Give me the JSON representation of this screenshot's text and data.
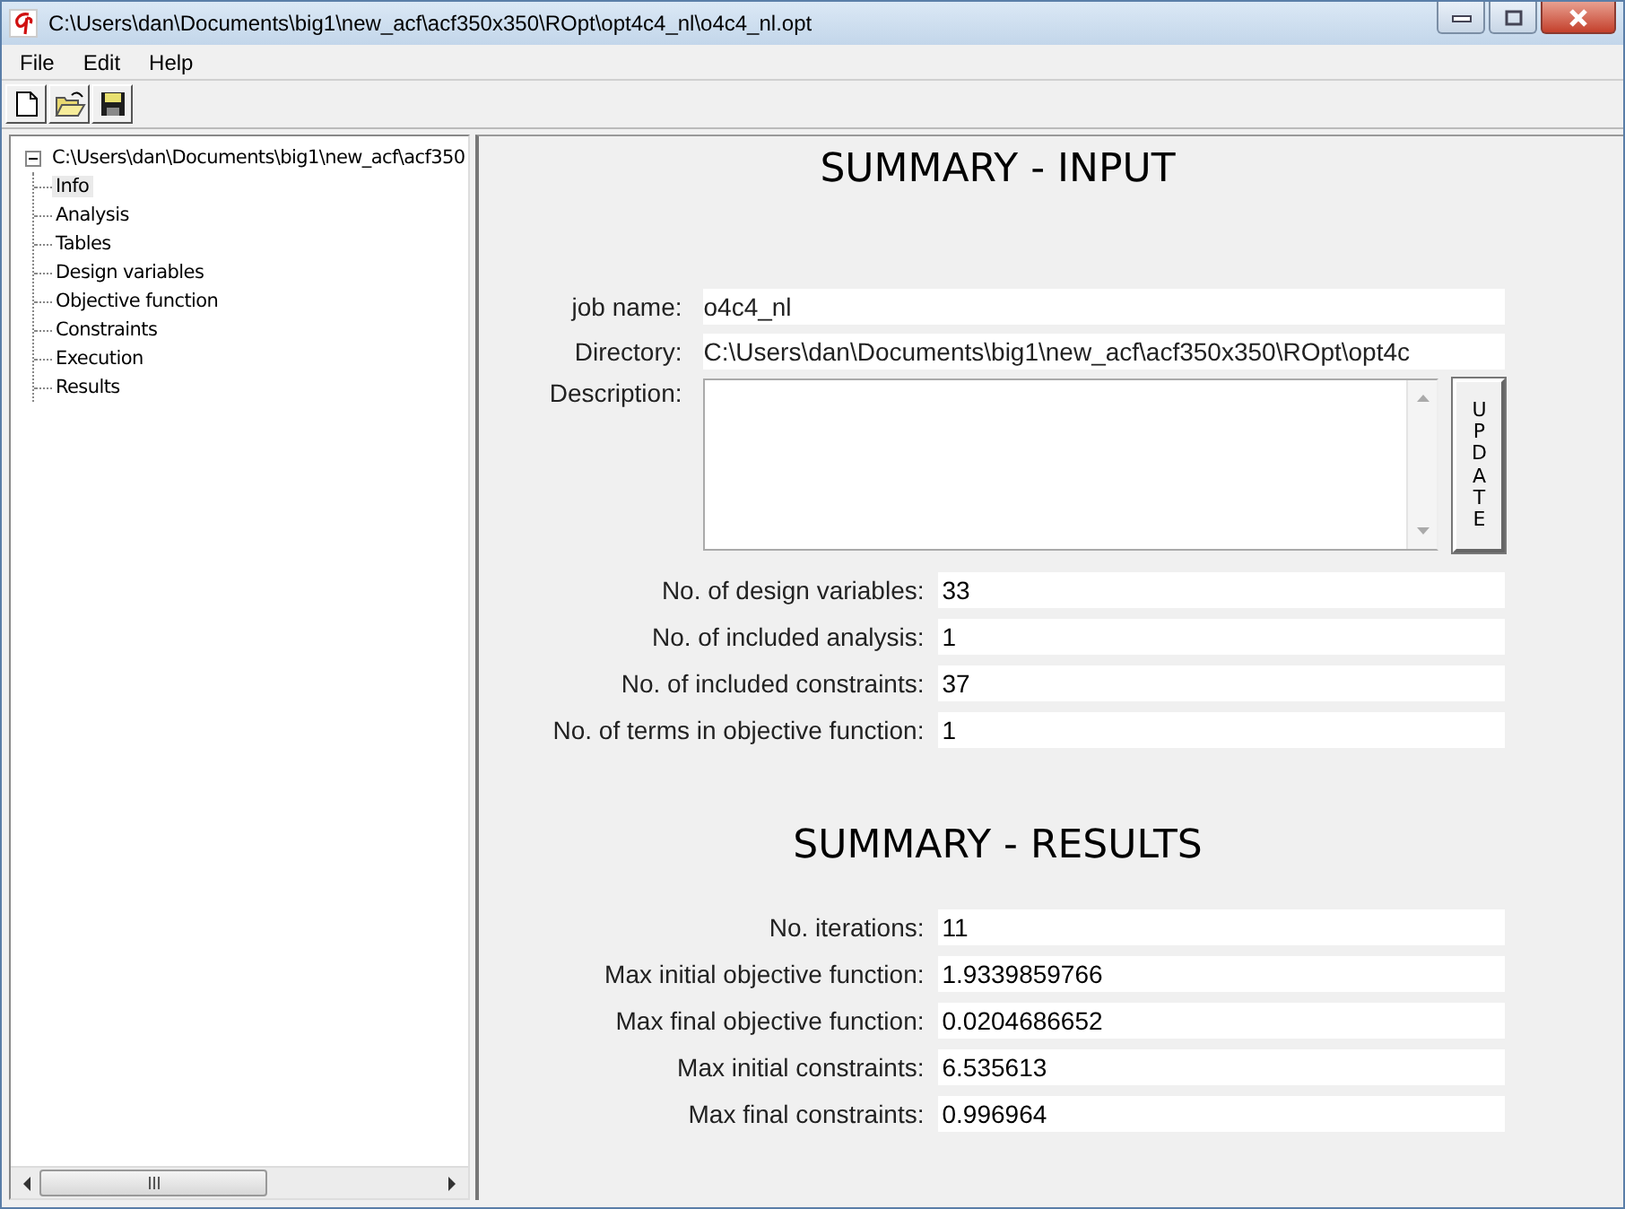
{
  "window": {
    "title": "C:\\Users\\dan\\Documents\\big1\\new_acf\\acf350x350\\ROpt\\opt4c4_nl\\o4c4_nl.opt"
  },
  "menu": [
    "File",
    "Edit",
    "Help"
  ],
  "tree": {
    "label": "C:\\Users\\dan\\Documents\\big1\\new_acf\\acf350",
    "expanded": true,
    "children": [
      {
        "label": "Info",
        "selected": true
      },
      {
        "label": "Analysis",
        "selected": false
      },
      {
        "label": "Tables",
        "selected": false
      },
      {
        "label": "Design variables",
        "selected": false
      },
      {
        "label": "Objective function",
        "selected": false
      },
      {
        "label": "Constraints",
        "selected": false
      },
      {
        "label": "Execution",
        "selected": false
      },
      {
        "label": "Results",
        "selected": false
      }
    ]
  },
  "input_summary": {
    "heading": "SUMMARY - INPUT",
    "job_name_label": "job name:",
    "job_name": "o4c4_nl",
    "directory_label": "Directory:",
    "directory": "C:\\Users\\dan\\Documents\\big1\\new_acf\\acf350x350\\ROpt\\opt4c",
    "description_label": "Description:",
    "update_button": "UPDATE",
    "stats": [
      {
        "label": "No. of design variables:",
        "value": "33"
      },
      {
        "label": "No. of included analysis:",
        "value": "1"
      },
      {
        "label": "No. of included constraints:",
        "value": "37"
      },
      {
        "label": "No. of terms in objective function:",
        "value": "1"
      }
    ]
  },
  "results_summary": {
    "heading": "SUMMARY - RESULTS",
    "stats": [
      {
        "label": "No. iterations:",
        "value": "11"
      },
      {
        "label": "Max initial objective function:",
        "value": "1.9339859766"
      },
      {
        "label": "Max final objective function:",
        "value": "0.0204686652"
      },
      {
        "label": "Max initial constraints:",
        "value": "6.535613"
      },
      {
        "label": "Max final constraints:",
        "value": "0.996964"
      }
    ]
  }
}
